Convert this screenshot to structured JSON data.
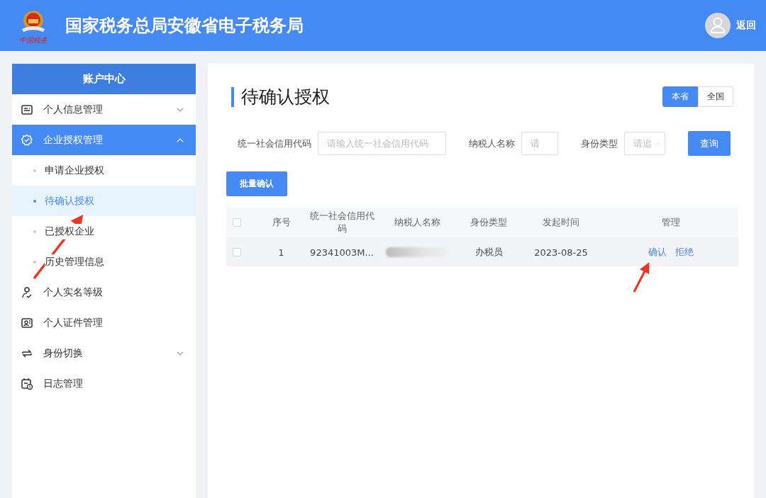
{
  "header": {
    "logo_caption": "中国税务",
    "title": "国家税务总局安徽省电子税务局",
    "back_label": "返回"
  },
  "sidebar": {
    "title": "账户中心",
    "items": [
      {
        "label": "个人信息管理",
        "selected": false,
        "expanded": false
      },
      {
        "label": "企业授权管理",
        "selected": true,
        "expanded": true,
        "children": [
          {
            "label": "申请企业授权",
            "selected": false
          },
          {
            "label": "待确认授权",
            "selected": true
          },
          {
            "label": "已授权企业",
            "selected": false
          },
          {
            "label": "历史管理信息",
            "selected": false
          }
        ]
      },
      {
        "label": "个人实名等级",
        "selected": false
      },
      {
        "label": "个人证件管理",
        "selected": false
      },
      {
        "label": "身份切换",
        "selected": false,
        "expanded": false
      },
      {
        "label": "日志管理",
        "selected": false
      }
    ]
  },
  "main": {
    "title": "待确认授权",
    "scope_tabs": [
      {
        "label": "本省",
        "selected": true
      },
      {
        "label": "全国",
        "selected": false
      }
    ],
    "filters": [
      {
        "label": "统一社会信用代码",
        "placeholder": "请输入统一社会信用代码",
        "kind": "text"
      },
      {
        "label": "纳税人名称",
        "placeholder": "请",
        "kind": "text"
      },
      {
        "label": "身份类型",
        "placeholder": "请追",
        "kind": "select"
      }
    ],
    "query_button": "查询",
    "batch_button": "批量确认",
    "table": {
      "columns": [
        "序号",
        "统一社会信用代码",
        "纳税人名称",
        "身份类型",
        "发起时间",
        "管理"
      ],
      "all_checked": false,
      "rows": [
        {
          "checked": false,
          "index": "1",
          "code": "92341003M...",
          "name_redacted": true,
          "identity": "办税员",
          "date": "2023-08-25",
          "actions": [
            "确认",
            "拒绝"
          ]
        }
      ]
    }
  }
}
